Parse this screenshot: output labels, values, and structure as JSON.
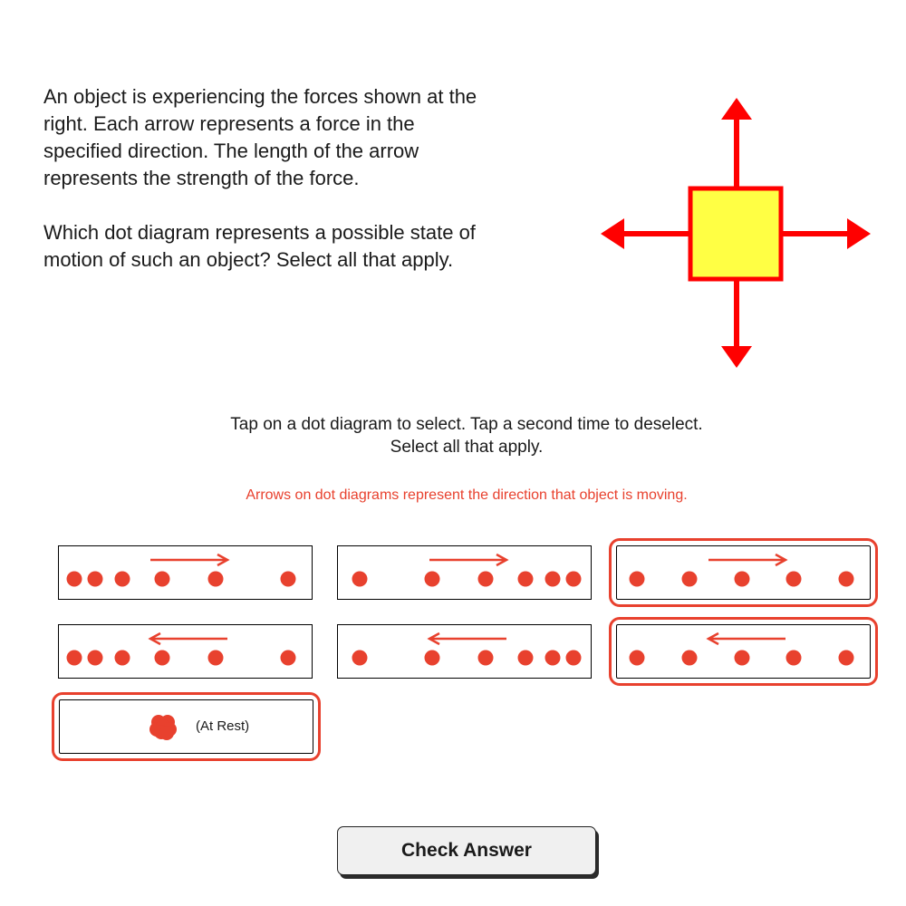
{
  "question": {
    "paragraph1_lines": [
      "An object is experiencing the forces shown at the",
      "right. Each arrow represents a force in the",
      "specified direction. The length of the arrow",
      "represents the strength of the force."
    ],
    "paragraph2_lines": [
      "Which dot diagram represents a possible state of",
      "motion of such an object? Select all that apply."
    ]
  },
  "instructions": {
    "line1": "Tap on a dot diagram to select. Tap a second time to deselect.",
    "line2": "Select all that apply."
  },
  "note": "Arrows on dot diagrams represent the direction that object is moving.",
  "colors": {
    "accent": "#e8412e",
    "force_arrow": "#ff0000",
    "object_fill": "#ffff44",
    "object_stroke": "#ff0000"
  },
  "options": [
    {
      "id": "opt1",
      "direction": "right",
      "pattern": "slowing-right",
      "selected": false
    },
    {
      "id": "opt2",
      "direction": "right",
      "pattern": "speeding-dense-end",
      "selected": false
    },
    {
      "id": "opt3",
      "direction": "right",
      "pattern": "constant",
      "selected": true
    },
    {
      "id": "opt4",
      "direction": "left",
      "pattern": "slowing-right",
      "selected": false
    },
    {
      "id": "opt5",
      "direction": "left",
      "pattern": "speeding-dense-end",
      "selected": false
    },
    {
      "id": "opt6",
      "direction": "left",
      "pattern": "constant",
      "selected": true
    },
    {
      "id": "opt7",
      "direction": "none",
      "pattern": "at-rest",
      "label": "(At Rest)",
      "selected": true
    }
  ],
  "check_button": "Check Answer"
}
